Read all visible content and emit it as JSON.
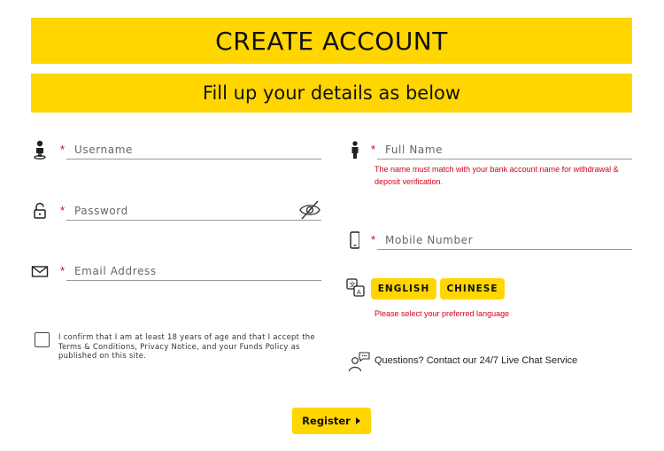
{
  "header": {
    "title": "CREATE ACCOUNT",
    "subtitle": "Fill up your details as below"
  },
  "form": {
    "required_marker": "*",
    "username": {
      "placeholder": "Username",
      "value": "",
      "icon": "user-icon"
    },
    "password": {
      "placeholder": "Password",
      "value": "",
      "icon": "unlock-icon",
      "toggle_icon": "eye-off-icon"
    },
    "email": {
      "placeholder": "Email Address",
      "value": "",
      "icon": "envelope-icon"
    },
    "full_name": {
      "placeholder": "Full Name",
      "value": "",
      "icon": "person-icon",
      "error": "The name must match with your bank account name for withdrawal & deposit verification."
    },
    "mobile": {
      "placeholder": "Mobile Number",
      "value": "",
      "icon": "mobile-phone-icon"
    },
    "language": {
      "icon": "translate-icon",
      "options": [
        "ENGLISH",
        "CHINESE"
      ],
      "error": "Please select your preferred language"
    },
    "consent": {
      "text": "I confirm that I am at least 18 years of age and that I accept the Terms & Conditions, Privacy Notice, and your Funds Policy as published on this site.",
      "checked": false
    },
    "chat": {
      "icon": "live-chat-icon",
      "text": "Questions? Contact our 24/7 Live Chat Service"
    },
    "register_label": "Register"
  },
  "colors": {
    "accent": "#ffd600",
    "error": "#d0021b",
    "text": "#333333"
  }
}
